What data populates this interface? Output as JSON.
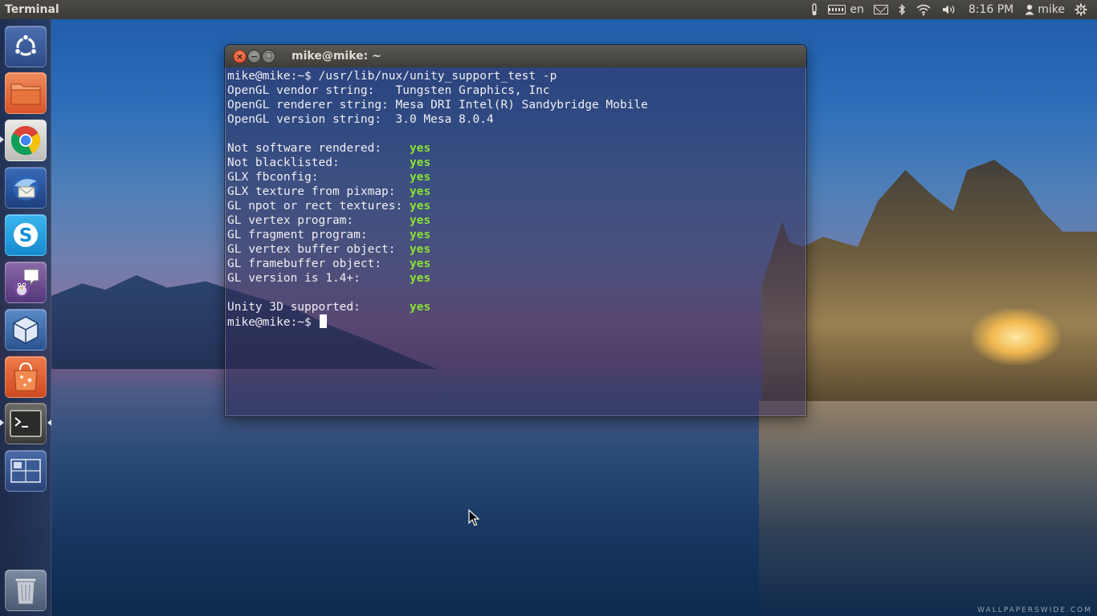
{
  "panel": {
    "app_title": "Terminal",
    "keyboard_layout": "en",
    "clock": "8:16 PM",
    "user_name": "mike",
    "icons": [
      "thermometer-icon",
      "keyboard-icon",
      "mail-icon",
      "bluetooth-icon",
      "wifi-icon",
      "volume-icon",
      "user-icon",
      "power-gear-icon"
    ]
  },
  "launcher": {
    "items": [
      {
        "name": "dash-home",
        "icon": "ubuntu-logo-icon",
        "color": "#3a5a9a",
        "running": false
      },
      {
        "name": "files",
        "icon": "folder-icon",
        "color": "#e0642e",
        "running": false
      },
      {
        "name": "chrome",
        "icon": "chrome-icon",
        "color": "#3aa14a",
        "running": true
      },
      {
        "name": "thunderbird",
        "icon": "thunderbird-icon",
        "color": "#2a5aa0",
        "running": false
      },
      {
        "name": "skype",
        "icon": "skype-icon",
        "color": "#1aa6e6",
        "running": false
      },
      {
        "name": "pidgin",
        "icon": "pidgin-icon",
        "color": "#6a4a8a",
        "running": false
      },
      {
        "name": "virtualbox",
        "icon": "virtualbox-icon",
        "color": "#3a6aa8",
        "running": false
      },
      {
        "name": "software-center",
        "icon": "shopping-bag-icon",
        "color": "#e2542a",
        "running": false
      },
      {
        "name": "terminal",
        "icon": "terminal-icon",
        "color": "#4a4a48",
        "running": true,
        "focused": true
      },
      {
        "name": "workspace-switcher",
        "icon": "workspace-icon",
        "color": "#3c5a90",
        "running": false
      },
      {
        "name": "trash",
        "icon": "trash-icon",
        "color": "#56677f",
        "running": false
      }
    ]
  },
  "window": {
    "title": "mike@mike: ~",
    "close_glyph": "×",
    "min_glyph": "−",
    "max_glyph": "□"
  },
  "terminal": {
    "lines": [
      {
        "text": "mike@mike:~$ /usr/lib/nux/unity_support_test -p",
        "value": ""
      },
      {
        "text": "OpenGL vendor string:   Tungsten Graphics, Inc",
        "value": ""
      },
      {
        "text": "OpenGL renderer string: Mesa DRI Intel(R) Sandybridge Mobile",
        "value": ""
      },
      {
        "text": "OpenGL version string:  3.0 Mesa 8.0.4",
        "value": ""
      },
      {
        "text": "",
        "value": ""
      },
      {
        "text": "Not software rendered:    ",
        "value": "yes"
      },
      {
        "text": "Not blacklisted:          ",
        "value": "yes"
      },
      {
        "text": "GLX fbconfig:             ",
        "value": "yes"
      },
      {
        "text": "GLX texture from pixmap:  ",
        "value": "yes"
      },
      {
        "text": "GL npot or rect textures: ",
        "value": "yes"
      },
      {
        "text": "GL vertex program:        ",
        "value": "yes"
      },
      {
        "text": "GL fragment program:      ",
        "value": "yes"
      },
      {
        "text": "GL vertex buffer object:  ",
        "value": "yes"
      },
      {
        "text": "GL framebuffer object:    ",
        "value": "yes"
      },
      {
        "text": "GL version is 1.4+:       ",
        "value": "yes"
      },
      {
        "text": "",
        "value": ""
      },
      {
        "text": "Unity 3D supported:       ",
        "value": "yes"
      }
    ],
    "prompt": "mike@mike:~$ ",
    "value_color": "#8ae234"
  },
  "desktop": {
    "watermark": "WALLPAPERSWIDE.COM"
  }
}
